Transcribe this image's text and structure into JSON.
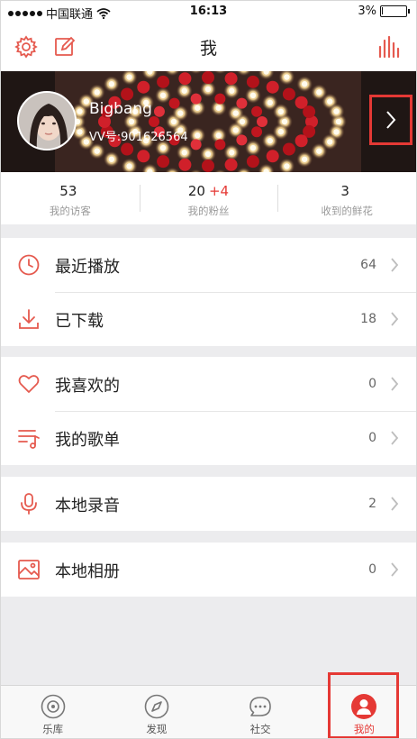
{
  "status_bar": {
    "carrier": "中国联通",
    "time": "16:13",
    "battery": "3%",
    "battery_level": 0.03
  },
  "nav": {
    "title": "我",
    "left_icons": [
      "gear-icon",
      "edit-icon"
    ],
    "right_icon": "equalizer-icon"
  },
  "profile": {
    "username": "Bigbang",
    "user_id": "VV号:901626564"
  },
  "stats": [
    {
      "value": "53",
      "plus": "",
      "label": "我的访客"
    },
    {
      "value": "20",
      "plus": "+4",
      "label": "我的粉丝"
    },
    {
      "value": "3",
      "plus": "",
      "label": "收到的鲜花"
    }
  ],
  "menu": {
    "recent_play": {
      "label": "最近播放",
      "count": "64"
    },
    "downloaded": {
      "label": "已下载",
      "count": "18"
    },
    "favorites": {
      "label": "我喜欢的",
      "count": "0"
    },
    "playlists": {
      "label": "我的歌单",
      "count": "0"
    },
    "recordings": {
      "label": "本地录音",
      "count": "2"
    },
    "album": {
      "label": "本地相册",
      "count": "0"
    }
  },
  "tabs": [
    {
      "label": "乐库",
      "icon": "disc-icon",
      "active": false
    },
    {
      "label": "发现",
      "icon": "compass-icon",
      "active": false
    },
    {
      "label": "社交",
      "icon": "chat-bubble-icon",
      "active": false
    },
    {
      "label": "我的",
      "icon": "person-icon",
      "active": true
    }
  ],
  "colors": {
    "accent": "#e53935",
    "background": "#ececee"
  }
}
